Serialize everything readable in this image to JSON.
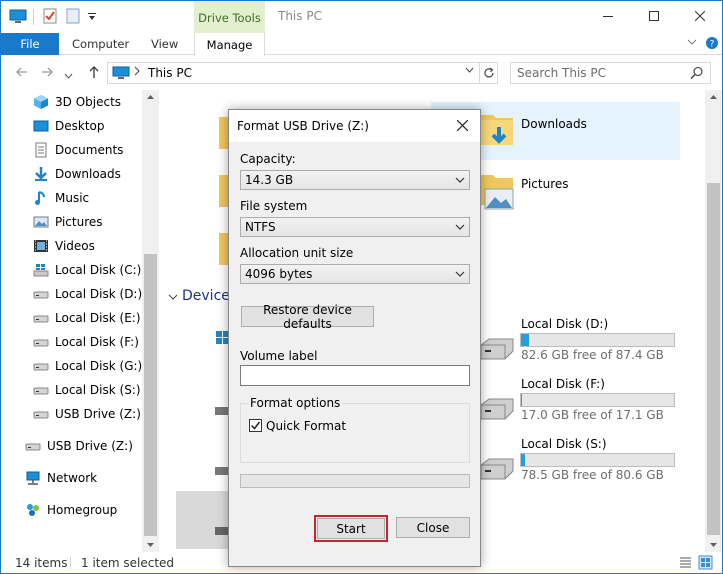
{
  "window": {
    "title": "This PC",
    "context_tab": "Drive Tools"
  },
  "ribbon": {
    "tabs": [
      "File",
      "Computer",
      "View",
      "Manage"
    ]
  },
  "address": {
    "crumb": "This PC",
    "search_placeholder": "Search This PC"
  },
  "sidebar": {
    "items": [
      {
        "label": "3D Objects",
        "icon": "3d-objects-icon"
      },
      {
        "label": "Desktop",
        "icon": "desktop-icon"
      },
      {
        "label": "Documents",
        "icon": "documents-icon"
      },
      {
        "label": "Downloads",
        "icon": "downloads-icon"
      },
      {
        "label": "Music",
        "icon": "music-icon"
      },
      {
        "label": "Pictures",
        "icon": "pictures-icon"
      },
      {
        "label": "Videos",
        "icon": "videos-icon"
      },
      {
        "label": "Local Disk (C:)",
        "icon": "windows-drive-icon"
      },
      {
        "label": "Local Disk (D:)",
        "icon": "drive-icon"
      },
      {
        "label": "Local Disk (E:)",
        "icon": "drive-icon"
      },
      {
        "label": "Local Disk (F:)",
        "icon": "drive-icon"
      },
      {
        "label": "Local Disk (G:)",
        "icon": "drive-icon"
      },
      {
        "label": "Local Disk (S:)",
        "icon": "drive-icon"
      },
      {
        "label": "USB Drive (Z:)",
        "icon": "usb-drive-icon"
      },
      {
        "label": "USB Drive (Z:)",
        "icon": "usb-drive-icon"
      },
      {
        "label": "Network",
        "icon": "network-icon"
      },
      {
        "label": "Homegroup",
        "icon": "homegroup-icon"
      }
    ]
  },
  "content": {
    "folders": [
      {
        "label": "Downloads",
        "icon": "downloads-folder-icon"
      },
      {
        "label": "Pictures",
        "icon": "pictures-folder-icon"
      }
    ],
    "devices_header": "Device",
    "drives": [
      {
        "label": "Local Disk (D:)",
        "free": "82.6 GB free of 87.4 GB",
        "used_fraction": 0.055
      },
      {
        "label": "Local Disk (F:)",
        "free": "17.0 GB free of 17.1 GB",
        "used_fraction": 0.006
      },
      {
        "label": "Local Disk (S:)",
        "free": "78.5 GB free of 80.6 GB",
        "used_fraction": 0.026
      }
    ]
  },
  "status": {
    "items_count": "14 items",
    "selected": "1 item selected"
  },
  "dialog": {
    "title": "Format USB Drive (Z:)",
    "capacity_label": "Capacity:",
    "capacity_value": "14.3 GB",
    "filesystem_label": "File system",
    "filesystem_value": "NTFS",
    "allocation_label": "Allocation unit size",
    "allocation_value": "4096 bytes",
    "restore_button": "Restore device defaults",
    "volume_label": "Volume label",
    "volume_value": "",
    "format_options_label": "Format options",
    "quick_format_label": "Quick Format",
    "quick_format_checked": true,
    "progress_fraction": 0,
    "start_button": "Start",
    "close_button": "Close",
    "highlight_color": "#c8242b"
  },
  "colors": {
    "accent": "#1979ca",
    "drive_tools_bg": "#e3f0cf",
    "drive_bar_fill": "#26a0da",
    "selection_bg": "#e5f3ff"
  }
}
